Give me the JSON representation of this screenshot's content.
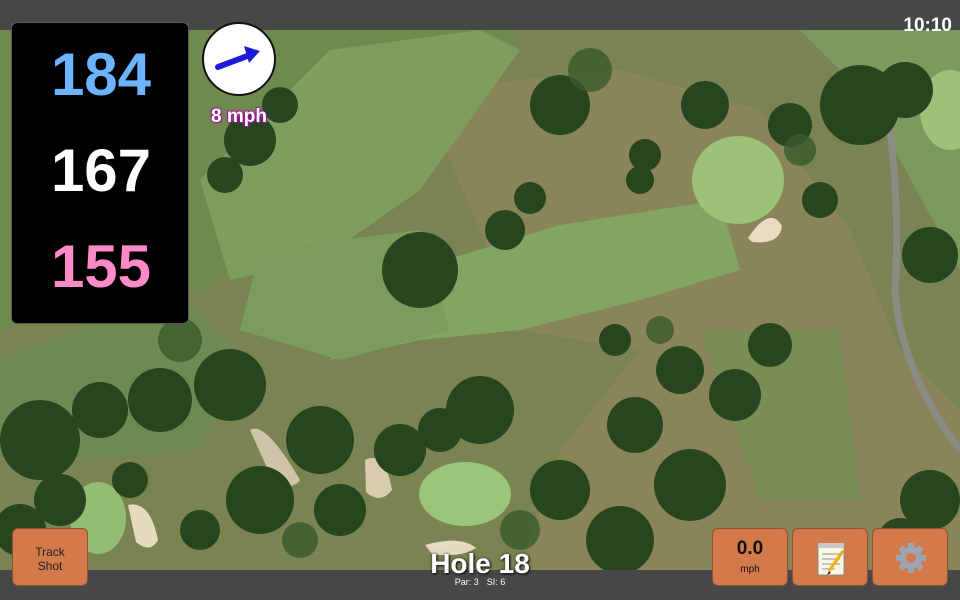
{
  "status": {
    "time": "10:10"
  },
  "distances": {
    "back": "184",
    "middle": "167",
    "front": "155"
  },
  "wind": {
    "speed": "8 mph",
    "direction_icon": "wind-arrow"
  },
  "hole": {
    "title": "Hole 18",
    "par": "Par: 3",
    "stroke_index": "SI: 6"
  },
  "buttons": {
    "track_shot_line1": "Track",
    "track_shot_line2": "Shot",
    "speed_value": "0.0",
    "speed_unit": "mph",
    "notes_icon": "notepad-icon",
    "settings_icon": "gear-icon"
  },
  "colors": {
    "back_distance": "#6cb4ff",
    "middle_distance": "#ffffff",
    "front_distance": "#ff8ac8",
    "button": "#d47a4a",
    "wind_arrow": "#1a1ad8"
  }
}
